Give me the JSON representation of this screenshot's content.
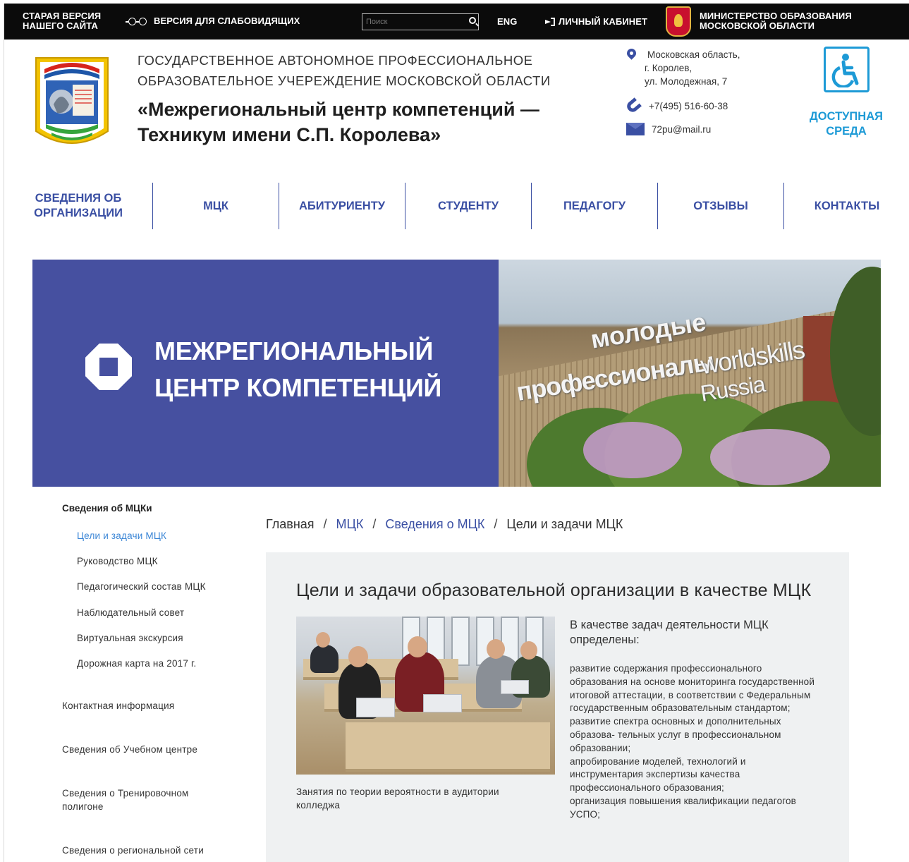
{
  "topbar": {
    "old_version": "Старая версия нашего сайта",
    "vision_version": "Версия для слабовидящих",
    "search_placeholder": "Поиск",
    "lang": "ENG",
    "cabinet": "Личный кабинет",
    "ministry": "Министерство образования Московской области"
  },
  "header": {
    "org_line": "ГОСУДАРСТВЕННОЕ АВТОНОМНОЕ ПРОФЕССИОНАЛЬНОЕ ОБРАЗОВАТЕЛЬНОЕ УЧЕРЕЖДЕНИЕ МОСКОВСКОЙ ОБЛАСТИ",
    "org_name": "«Межрегиональный центр компетенций — Техникум имени С.П. Королева»",
    "address_line1": "Московская область,",
    "address_line2": "г. Королев,",
    "address_line3": "ул. Молодежная, 7",
    "phone": "+7(495) 516-60-38",
    "email": "72pu@mail.ru",
    "accessible_label": "Доступная среда"
  },
  "nav": {
    "items": [
      "Сведения об организации",
      "МЦК",
      "Абитуриенту",
      "Студенту",
      "Педагогу",
      "Отзывы",
      "Контакты"
    ]
  },
  "banner": {
    "title_line1": "Межрегиональный",
    "title_line2": "центр компетенций",
    "photo_sign1": "молодые",
    "photo_sign2": "профессионалы",
    "photo_sign3": "worldskills",
    "photo_sign4": "Russia"
  },
  "sidebar": {
    "heading": "Сведения об МЦКи",
    "subitems": [
      "Цели и задачи МЦК",
      "Руководство МЦК",
      "Педагогический состав МЦК",
      "Наблюдательный совет",
      "Виртуальная экскурсия",
      "Дорожная карта на 2017 г."
    ],
    "items": [
      "Контактная информация",
      "Сведения об Учебном центре",
      "Сведения о Тренировочном полигоне",
      "Сведения о региональной сети"
    ]
  },
  "breadcrumb": {
    "home": "Главная",
    "mck": "МЦК",
    "info": "Сведения о МЦК",
    "current": "Цели и задачи МЦК",
    "sep": "/"
  },
  "content": {
    "title": "Цели и задачи образовательной организации в качестве МЦК",
    "photo_caption": "Занятия по теории вероятности в аудитории колледжа",
    "lead": "В качестве задач деятельности МЦК определены:",
    "task1": "развитие содержания профессионального образования на основе мониторинга государственной итоговой аттестации, в соответствии с Федеральным государственным образовательным стандартом;",
    "task2": "развитие спектра основных и дополнительных образова- тельных услуг в профессиональном образовании;",
    "task3": "апробирование моделей, технологий и инструментария экспертизы качества профессионального образования;",
    "task4": "организация повышения квалификации педагогов УСПО;"
  },
  "colors": {
    "brand_blue": "#3a4fa3",
    "banner_blue": "#4650a0",
    "accent_cyan": "#1d9ad6",
    "active_link": "#3b86d6",
    "topbar_bg": "#0b0b0b"
  }
}
